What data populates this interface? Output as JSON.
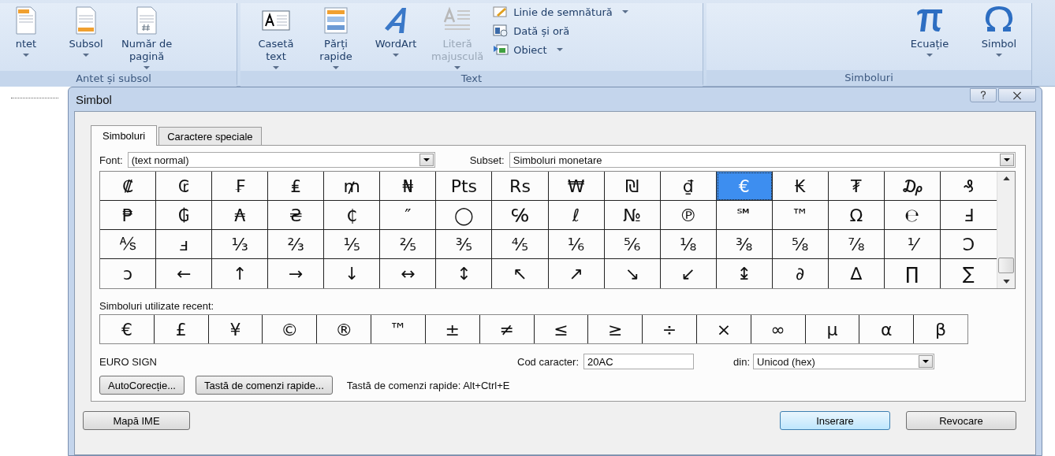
{
  "ribbon": {
    "groups": [
      {
        "label": "Antet și subsol",
        "items": [
          {
            "label": "ntet",
            "kind": "large",
            "dropdown": true,
            "disabled": false
          },
          {
            "label": "Subsol",
            "kind": "large",
            "dropdown": true,
            "disabled": false
          },
          {
            "label": "Număr de\npagină",
            "kind": "large",
            "dropdown": true,
            "disabled": false
          }
        ]
      },
      {
        "label": "Text",
        "items": [
          {
            "label": "Casetă\ntext",
            "kind": "large",
            "dropdown": true,
            "disabled": false
          },
          {
            "label": "Părți\nrapide",
            "kind": "large",
            "dropdown": true,
            "disabled": false
          },
          {
            "label": "WordArt",
            "kind": "large",
            "dropdown": true,
            "disabled": false
          },
          {
            "label": "Literă\nmajusculă",
            "kind": "large",
            "dropdown": true,
            "disabled": true
          },
          {
            "label": "Linie de semnătură",
            "kind": "small",
            "dropdown": true,
            "disabled": false
          },
          {
            "label": "Dată și oră",
            "kind": "small",
            "dropdown": false,
            "disabled": false
          },
          {
            "label": "Obiect",
            "kind": "small",
            "dropdown": true,
            "disabled": false
          }
        ]
      },
      {
        "label": "Simboluri",
        "items": [
          {
            "label": "Ecuație",
            "kind": "large",
            "dropdown": true,
            "disabled": false
          },
          {
            "label": "Simbol",
            "kind": "large",
            "dropdown": true,
            "disabled": false
          }
        ]
      }
    ]
  },
  "dialog": {
    "title": "Simbol",
    "tabs": [
      {
        "label": "Simboluri",
        "selected": true
      },
      {
        "label": "Caractere speciale",
        "selected": false
      }
    ],
    "font": {
      "label": "Font:",
      "value": "(text normal)"
    },
    "subset": {
      "label": "Subset:",
      "value": "Simboluri monetare"
    },
    "symbols": [
      {
        "char": "₡",
        "selected": false
      },
      {
        "char": "₢",
        "selected": false
      },
      {
        "char": "₣",
        "selected": false
      },
      {
        "char": "₤",
        "selected": false
      },
      {
        "char": "₥",
        "selected": false
      },
      {
        "char": "₦",
        "selected": false
      },
      {
        "char": "Pts",
        "selected": false
      },
      {
        "char": "Rs",
        "selected": false
      },
      {
        "char": "₩",
        "selected": false
      },
      {
        "char": "₪",
        "selected": false
      },
      {
        "char": "₫",
        "selected": false
      },
      {
        "char": "€",
        "selected": true
      },
      {
        "char": "₭",
        "selected": false
      },
      {
        "char": "₮",
        "selected": false
      },
      {
        "char": "₯",
        "selected": false
      },
      {
        "char": "₰",
        "selected": false
      },
      {
        "char": "₱",
        "selected": false
      },
      {
        "char": "₲",
        "selected": false
      },
      {
        "char": "₳",
        "selected": false
      },
      {
        "char": "₴",
        "selected": false
      },
      {
        "char": "₵",
        "selected": false
      },
      {
        "char": "″",
        "selected": false
      },
      {
        "char": "◯",
        "selected": false
      },
      {
        "char": "℅",
        "selected": false
      },
      {
        "char": "ℓ",
        "selected": false
      },
      {
        "char": "№",
        "selected": false
      },
      {
        "char": "℗",
        "selected": false
      },
      {
        "char": "℠",
        "selected": false
      },
      {
        "char": "™",
        "selected": false
      },
      {
        "char": "Ω",
        "selected": false
      },
      {
        "char": "℮",
        "selected": false
      },
      {
        "char": "Ⅎ",
        "selected": false
      },
      {
        "char": "⅍",
        "selected": false
      },
      {
        "char": "ⅎ",
        "selected": false
      },
      {
        "char": "⅓",
        "selected": false
      },
      {
        "char": "⅔",
        "selected": false
      },
      {
        "char": "⅕",
        "selected": false
      },
      {
        "char": "⅖",
        "selected": false
      },
      {
        "char": "⅗",
        "selected": false
      },
      {
        "char": "⅘",
        "selected": false
      },
      {
        "char": "⅙",
        "selected": false
      },
      {
        "char": "⅚",
        "selected": false
      },
      {
        "char": "⅛",
        "selected": false
      },
      {
        "char": "⅜",
        "selected": false
      },
      {
        "char": "⅝",
        "selected": false
      },
      {
        "char": "⅞",
        "selected": false
      },
      {
        "char": "⅟",
        "selected": false
      },
      {
        "char": "Ↄ",
        "selected": false
      },
      {
        "char": "ↄ",
        "selected": false
      },
      {
        "char": "←",
        "selected": false
      },
      {
        "char": "↑",
        "selected": false
      },
      {
        "char": "→",
        "selected": false
      },
      {
        "char": "↓",
        "selected": false
      },
      {
        "char": "↔",
        "selected": false
      },
      {
        "char": "↕",
        "selected": false
      },
      {
        "char": "↖",
        "selected": false
      },
      {
        "char": "↗",
        "selected": false
      },
      {
        "char": "↘",
        "selected": false
      },
      {
        "char": "↙",
        "selected": false
      },
      {
        "char": "↨",
        "selected": false
      },
      {
        "char": "∂",
        "selected": false
      },
      {
        "char": "∆",
        "selected": false
      },
      {
        "char": "∏",
        "selected": false
      },
      {
        "char": "∑",
        "selected": false
      }
    ],
    "recent_label": "Simboluri utilizate recent:",
    "recent": [
      "€",
      "£",
      "¥",
      "©",
      "®",
      "™",
      "±",
      "≠",
      "≤",
      "≥",
      "÷",
      "×",
      "∞",
      "µ",
      "α",
      "β"
    ],
    "char_name": "EURO SIGN",
    "code": {
      "label": "Cod caracter:",
      "value": "20AC"
    },
    "from": {
      "label": "din:",
      "value": "Unicod (hex)"
    },
    "autocorrect_button": "AutoCorecție...",
    "shortcut_button": "Tastă de comenzi rapide...",
    "shortcut_text": "Tastă de comenzi rapide: Alt+Ctrl+E",
    "ime_button": "Mapă IME",
    "insert_button": "Inserare",
    "cancel_button": "Revocare"
  }
}
